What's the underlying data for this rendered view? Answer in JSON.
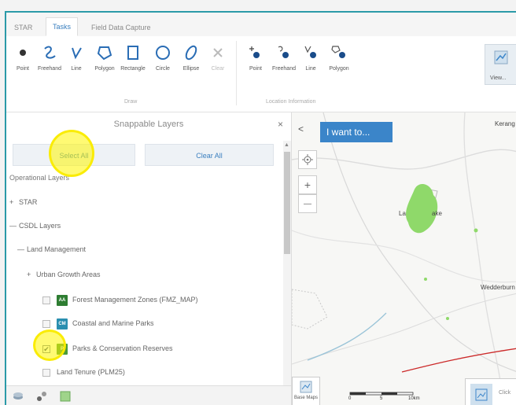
{
  "tabs": [
    {
      "label": "STAR"
    },
    {
      "label": "Tasks"
    },
    {
      "label": "Field Data Capture"
    }
  ],
  "ribbon": {
    "draw_tools": [
      {
        "label": "Point",
        "icon": "point-icon"
      },
      {
        "label": "Freehand",
        "icon": "freehand-icon"
      },
      {
        "label": "Line",
        "icon": "line-icon"
      },
      {
        "label": "Polygon",
        "icon": "polygon-icon"
      },
      {
        "label": "Rectangle",
        "icon": "rectangle-icon"
      },
      {
        "label": "Circle",
        "icon": "circle-icon"
      },
      {
        "label": "Ellipse",
        "icon": "ellipse-icon"
      },
      {
        "label": "Clear",
        "icon": "clear-icon"
      }
    ],
    "draw_group_label": "Draw",
    "location_tools": [
      {
        "label": "Point",
        "icon": "location-point-icon"
      },
      {
        "label": "Freehand",
        "icon": "location-freehand-icon"
      },
      {
        "label": "Line",
        "icon": "location-line-icon"
      },
      {
        "label": "Polygon",
        "icon": "location-polygon-icon"
      }
    ],
    "location_group_label": "Location Information",
    "view_label": "View..."
  },
  "panel": {
    "title": "Snappable Layers",
    "close": "×",
    "select_all": "Select All",
    "clear_all": "Clear All",
    "section_label": "Operational Layers",
    "rows": [
      {
        "toggle": "+",
        "label": "STAR"
      },
      {
        "toggle": "—",
        "label": "CSDL Layers"
      },
      {
        "toggle": "—",
        "label": "Land Management"
      },
      {
        "toggle": "+",
        "label": "Urban Growth Areas"
      },
      {
        "label": "Forest Management Zones (FMZ_MAP)",
        "icon_text": "AA",
        "checked": false
      },
      {
        "label": "Coastal and Marine Parks",
        "icon_text": "CM",
        "checked": false
      },
      {
        "label": "Parks & Conservation Reserves",
        "icon_text": "P",
        "checked": true
      },
      {
        "label": "Land Tenure (PLM25)",
        "checked": false
      }
    ]
  },
  "map": {
    "i_want_to": "I want to...",
    "back_chevron": "<",
    "zoom_in": "+",
    "zoom_out": "—",
    "labels": [
      "La",
      "ake",
      "Wedderburn",
      "Kerang"
    ],
    "basemap_label": "Base Maps",
    "scale_labels": [
      "0",
      "5",
      "10km"
    ],
    "click_label": "Click"
  },
  "colors": {
    "frame": "#2b9aa8",
    "accent": "#3b85c9",
    "highlight": "#fff200",
    "park_green": "#8fd96a"
  }
}
